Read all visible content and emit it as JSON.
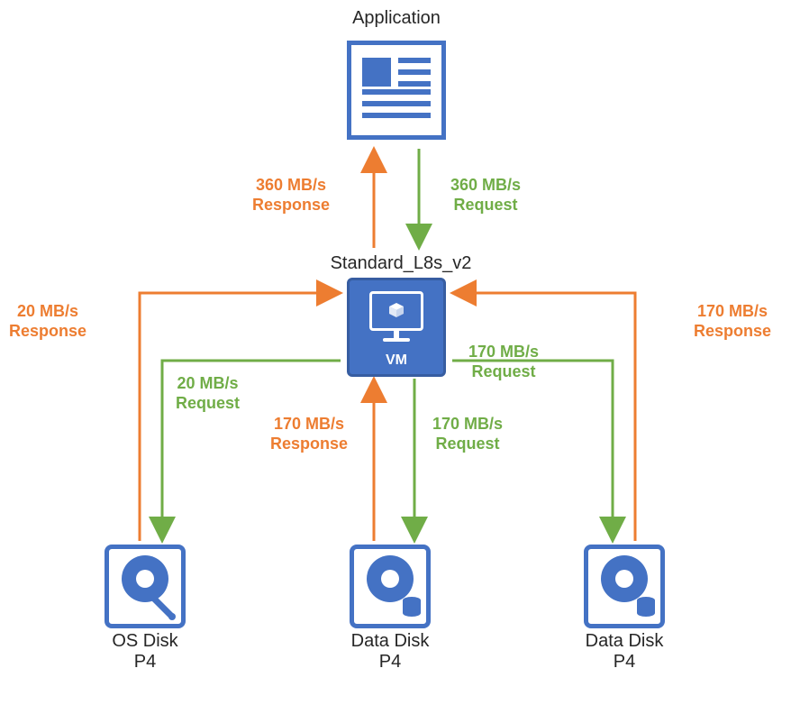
{
  "title_application": "Application",
  "vm_type_label": "Standard_L8s_v2",
  "vm_caption": "VM",
  "flows": {
    "app_to_vm_response": {
      "line1": "360 MB/s",
      "line2": "Response"
    },
    "app_to_vm_request": {
      "line1": "360 MB/s",
      "line2": "Request"
    },
    "os_disk_response": {
      "line1": "20 MB/s",
      "line2": "Response"
    },
    "os_disk_request": {
      "line1": "20 MB/s",
      "line2": "Request"
    },
    "data_disk_mid_response": {
      "line1": "170 MB/s",
      "line2": "Response"
    },
    "data_disk_mid_request": {
      "line1": "170 MB/s",
      "line2": "Request"
    },
    "data_disk_right_response": {
      "line1": "170 MB/s",
      "line2": "Response"
    },
    "data_disk_right_request": {
      "line1": "170 MB/s",
      "line2": "Request"
    }
  },
  "disks": {
    "os": {
      "name": "OS Disk",
      "tier": "P4"
    },
    "mid": {
      "name": "Data Disk",
      "tier": "P4"
    },
    "right": {
      "name": "Data Disk",
      "tier": "P4"
    }
  },
  "colors": {
    "primary_blue": "#4472C4",
    "orange": "#ED7D31",
    "green": "#70AD47"
  }
}
